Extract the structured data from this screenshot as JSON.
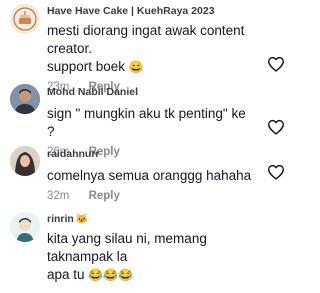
{
  "comments": [
    {
      "username": "Have Have Cake | KuehRaya 2023",
      "text_line1": "mesti diorang ingat awak content creator.",
      "text_line2": "support boek",
      "emoji": "😄",
      "time": "23m",
      "reply_label": "Reply",
      "avatar_icon": "cake-shop-logo-icon"
    },
    {
      "username": "Mohd Nabil Daniel",
      "text": "sign \" mungkin aku tk penting\" ke ?",
      "time": "26m",
      "reply_label": "Reply",
      "avatar_icon": "man-photo-avatar-icon"
    },
    {
      "username": "raidahnurr",
      "text": "comelnya semua oranggg hahaha",
      "time": "32m",
      "reply_label": "Reply",
      "avatar_icon": "hijab-woman-avatar-icon"
    },
    {
      "username": "rinrin",
      "username_badge": "🐱",
      "text_line1": "kita yang silau ni, memang taknampak la",
      "text_line2": "apa tu",
      "emoji": "😂😂😂",
      "time": "",
      "reply_label": "",
      "avatar_icon": "illustration-avatar-icon"
    }
  ],
  "like_icon": "heart-outline-icon"
}
